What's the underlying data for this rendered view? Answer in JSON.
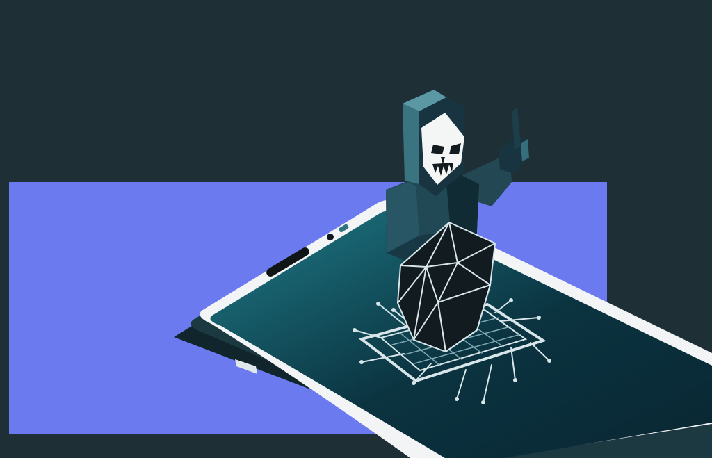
{
  "colors": {
    "background": "#1f2f36",
    "accent_block": "#6b7bef",
    "phone_body": "#f2f4f5",
    "phone_shadow": "#11252c",
    "screen_dark": "#0b3340",
    "screen_light": "#1f7b88",
    "figure_dark": "#173440",
    "figure_mid": "#2b5b68",
    "figure_light": "#4a8390",
    "mask": "#f4f6f6",
    "shield": "#111b20",
    "lines": "#d8e6ea"
  },
  "scene": {
    "description_icons": [
      "smartphone-icon",
      "hooded-figure-icon",
      "skull-mask-icon",
      "shield-icon",
      "circuit-grid-icon"
    ]
  }
}
